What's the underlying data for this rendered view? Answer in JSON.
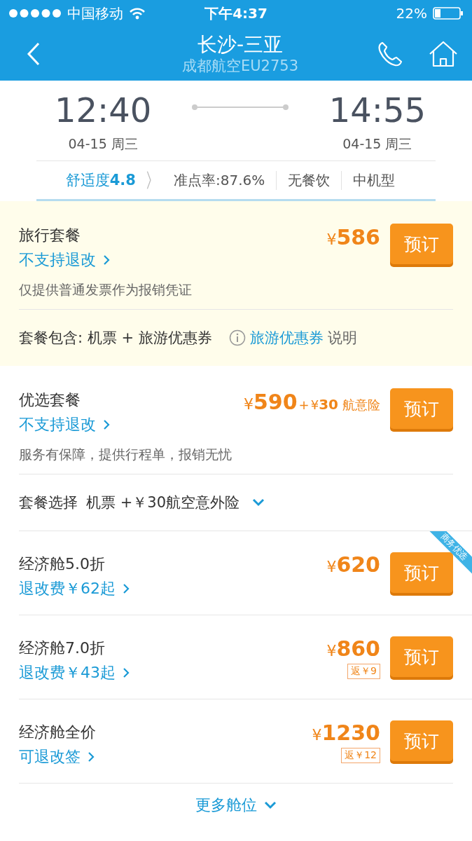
{
  "status_bar": {
    "carrier": "中国移动",
    "time": "下午4:37",
    "battery": "22%"
  },
  "nav": {
    "title": "长沙-三亚",
    "subtitle": "成都航空EU2753"
  },
  "flight": {
    "depart": {
      "time": "12:40",
      "date": "04-15 周三"
    },
    "arrive": {
      "time": "14:55",
      "date": "04-15 周三"
    }
  },
  "info": {
    "comfort_label": "舒适度",
    "comfort_score": "4.8",
    "items": [
      "准点率:87.6%",
      "无餐饮",
      "中机型"
    ]
  },
  "packages": [
    {
      "name": "旅行套餐",
      "highlighted": true,
      "currency": "¥",
      "price": "586",
      "policy": "不支持退改",
      "note": "仅提供普通发票作为报销凭证",
      "button": "预订",
      "footer": {
        "kind": "includes",
        "label": "套餐包含: 机票 + 旅游优惠券",
        "link": "旅游优惠券",
        "suffix": "说明"
      }
    },
    {
      "name": "优选套餐",
      "highlighted": false,
      "currency": "¥",
      "price": "590",
      "extra": {
        "plus": "+",
        "currency": "¥",
        "amount": "30",
        "label": "航意险"
      },
      "policy": "不支持退改",
      "note": "服务有保障，提供行程单，报销无忧",
      "button": "预订",
      "footer": {
        "kind": "select",
        "label": "套餐选择",
        "value": "机票 +￥30航空意外险"
      }
    }
  ],
  "fares": [
    {
      "name": "经济舱5.0折",
      "policy": "退改费￥62起",
      "currency": "¥",
      "price": "620",
      "button": "预订",
      "ribbon": "商务优选"
    },
    {
      "name": "经济舱7.0折",
      "policy": "退改费￥43起",
      "currency": "¥",
      "price": "860",
      "rebate": "返￥9",
      "button": "预订"
    },
    {
      "name": "经济舱全价",
      "policy": "可退改签",
      "currency": "¥",
      "price": "1230",
      "rebate": "返￥12",
      "button": "预订"
    }
  ],
  "more": {
    "label": "更多舱位"
  }
}
